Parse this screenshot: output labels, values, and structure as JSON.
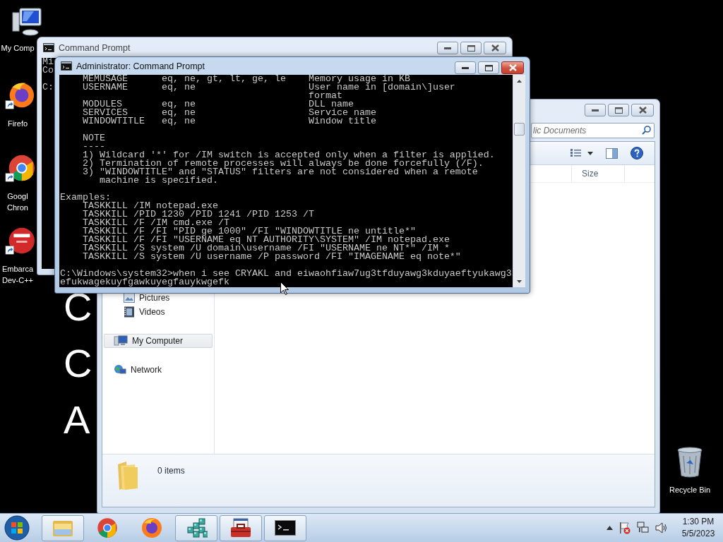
{
  "desktop": {
    "icons": [
      {
        "kind": "computer",
        "lines": [
          "My Comp"
        ]
      },
      {
        "kind": "firefox",
        "lines": [
          "Firefo"
        ]
      },
      {
        "kind": "chrome",
        "lines": [
          "Googl",
          "Chron"
        ]
      },
      {
        "kind": "devcpp",
        "lines": [
          "Embarca",
          "Dev-C++"
        ]
      }
    ],
    "wallpaper_text": [
      "C",
      "C",
      "A"
    ],
    "recycle_bin": {
      "label": "Recycle Bin"
    }
  },
  "explorer_window": {
    "active": false,
    "search": {
      "placeholder": "lic Documents"
    },
    "columns": [
      "Size"
    ],
    "nav_groups": [
      {
        "kind": "libraries",
        "items": [
          {
            "label": "Pictures",
            "kind": "pictures",
            "selected": false
          },
          {
            "label": "Videos",
            "kind": "videos",
            "selected": false
          }
        ]
      },
      {
        "kind": "computer",
        "items": [
          {
            "label": "My Computer",
            "kind": "computer",
            "selected": true
          }
        ]
      },
      {
        "kind": "network",
        "items": [
          {
            "label": "Network",
            "kind": "network",
            "selected": false
          }
        ]
      }
    ],
    "status": "0 items"
  },
  "back_console_window": {
    "title": "Command Prompt",
    "active": false,
    "blocks": [
      [
        "Mi",
        "Co"
      ],
      [
        "C:"
      ]
    ]
  },
  "console_window": {
    "title": "Administrator:  Command Prompt",
    "active": true,
    "blocks": [
      [
        "    MEMUSAGE      eq, ne, gt, lt, ge, le    Memory usage in KB",
        "    USERNAME      eq, ne                    User name in [domain\\]user",
        "                                            format",
        "    MODULES       eq, ne                    DLL name",
        "    SERVICES      eq, ne                    Service name",
        "    WINDOWTITLE   eq, ne                    Window title"
      ],
      [
        "    NOTE",
        "    ----",
        "    1) Wildcard '*' for /IM switch is accepted only when a filter is applied.",
        "    2) Termination of remote processes will always be done forcefully (/F).",
        "    3) \"WINDOWTITLE\" and \"STATUS\" filters are not considered when a remote",
        "       machine is specified."
      ],
      [
        "Examples:",
        "    TASKKILL /IM notepad.exe",
        "    TASKKILL /PID 1230 /PID 1241 /PID 1253 /T",
        "    TASKKILL /F /IM cmd.exe /T",
        "    TASKKILL /F /FI \"PID ge 1000\" /FI \"WINDOWTITLE ne untitle*\"",
        "    TASKKILL /F /FI \"USERNAME eq NT AUTHORITY\\SYSTEM\" /IM notepad.exe",
        "    TASKKILL /S system /U domain\\username /FI \"USERNAME ne NT*\" /IM *",
        "    TASKKILL /S system /U username /P password /FI \"IMAGENAME eq note*\""
      ],
      [
        "C:\\Windows\\system32>when i see CRYAKL and eiwaohfiaw7ug3tfduyawg3kduyaeftyukawg3",
        "efukwagekuyfgawkuyegfauykwgefk"
      ]
    ]
  },
  "taskbar": {
    "items": [
      {
        "kind": "explorer",
        "running": true
      },
      {
        "kind": "chrome",
        "running": false
      },
      {
        "kind": "firefox",
        "running": false
      },
      {
        "kind": "registry",
        "running": true
      },
      {
        "kind": "toolbox",
        "running": true
      },
      {
        "kind": "console",
        "running": true
      }
    ],
    "clock": {
      "time": "1:30 PM",
      "date": "5/5/2023"
    }
  }
}
